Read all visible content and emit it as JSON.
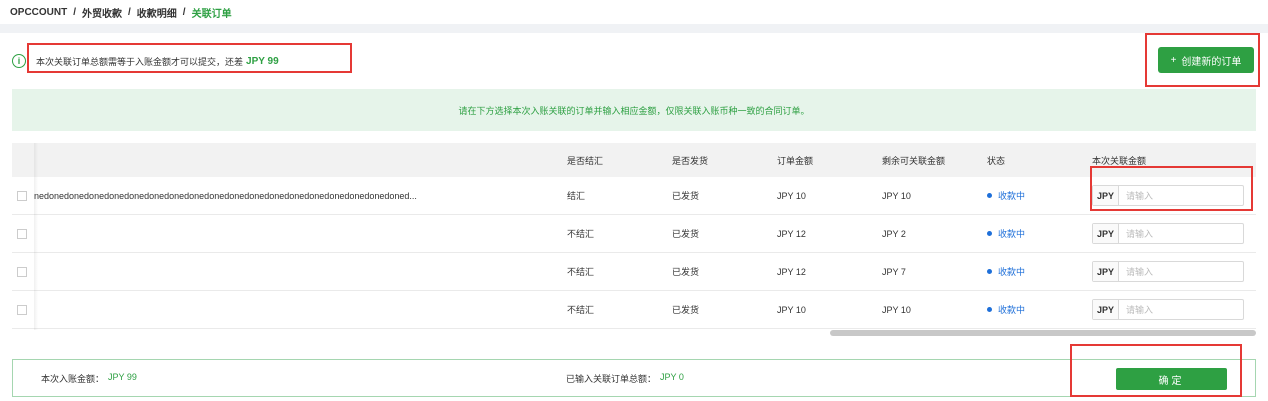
{
  "breadcrumb": [
    "OPCCOUNT",
    "外贸收款",
    "收款明细",
    "关联订单"
  ],
  "notice": {
    "icon": "info-icon",
    "text": "本次关联订单总额需等于入账金额才可以提交，还差",
    "amount": "JPY 99"
  },
  "create_button": {
    "icon": "+",
    "label": "创建新的订单"
  },
  "banner": "请在下方选择本次入账关联的订单并输入相应金额，仅限关联入账币种一致的合同订单。",
  "table": {
    "headers": [
      "",
      "是否结汇",
      "是否发货",
      "订单金额",
      "剩余可关联金额",
      "状态",
      "本次关联金额"
    ],
    "rows": [
      {
        "name": "nedonedonedonedonedonedonedonedonedonedonedonedonedonedonedonedonedonedoned...",
        "settle": "结汇",
        "ship": "已发货",
        "amount": "JPY 10",
        "remain": "JPY 10",
        "status": "收款中",
        "prefix": "JPY",
        "placeholder": "请输入"
      },
      {
        "name": "",
        "settle": "不结汇",
        "ship": "已发货",
        "amount": "JPY 12",
        "remain": "JPY 2",
        "status": "收款中",
        "prefix": "JPY",
        "placeholder": "请输入"
      },
      {
        "name": "",
        "settle": "不结汇",
        "ship": "已发货",
        "amount": "JPY 12",
        "remain": "JPY 7",
        "status": "收款中",
        "prefix": "JPY",
        "placeholder": "请输入"
      },
      {
        "name": "",
        "settle": "不结汇",
        "ship": "已发货",
        "amount": "JPY 10",
        "remain": "JPY 10",
        "status": "收款中",
        "prefix": "JPY",
        "placeholder": "请输入"
      }
    ]
  },
  "footer": {
    "income_label": "本次入账金额：",
    "income_value": "JPY 99",
    "entered_label": "已输入关联订单总额：",
    "entered_value": "JPY 0",
    "confirm_label": "确定"
  },
  "colors": {
    "accent": "#2ea043",
    "highlight_border": "#e53935",
    "status": "#1e6fd9"
  }
}
